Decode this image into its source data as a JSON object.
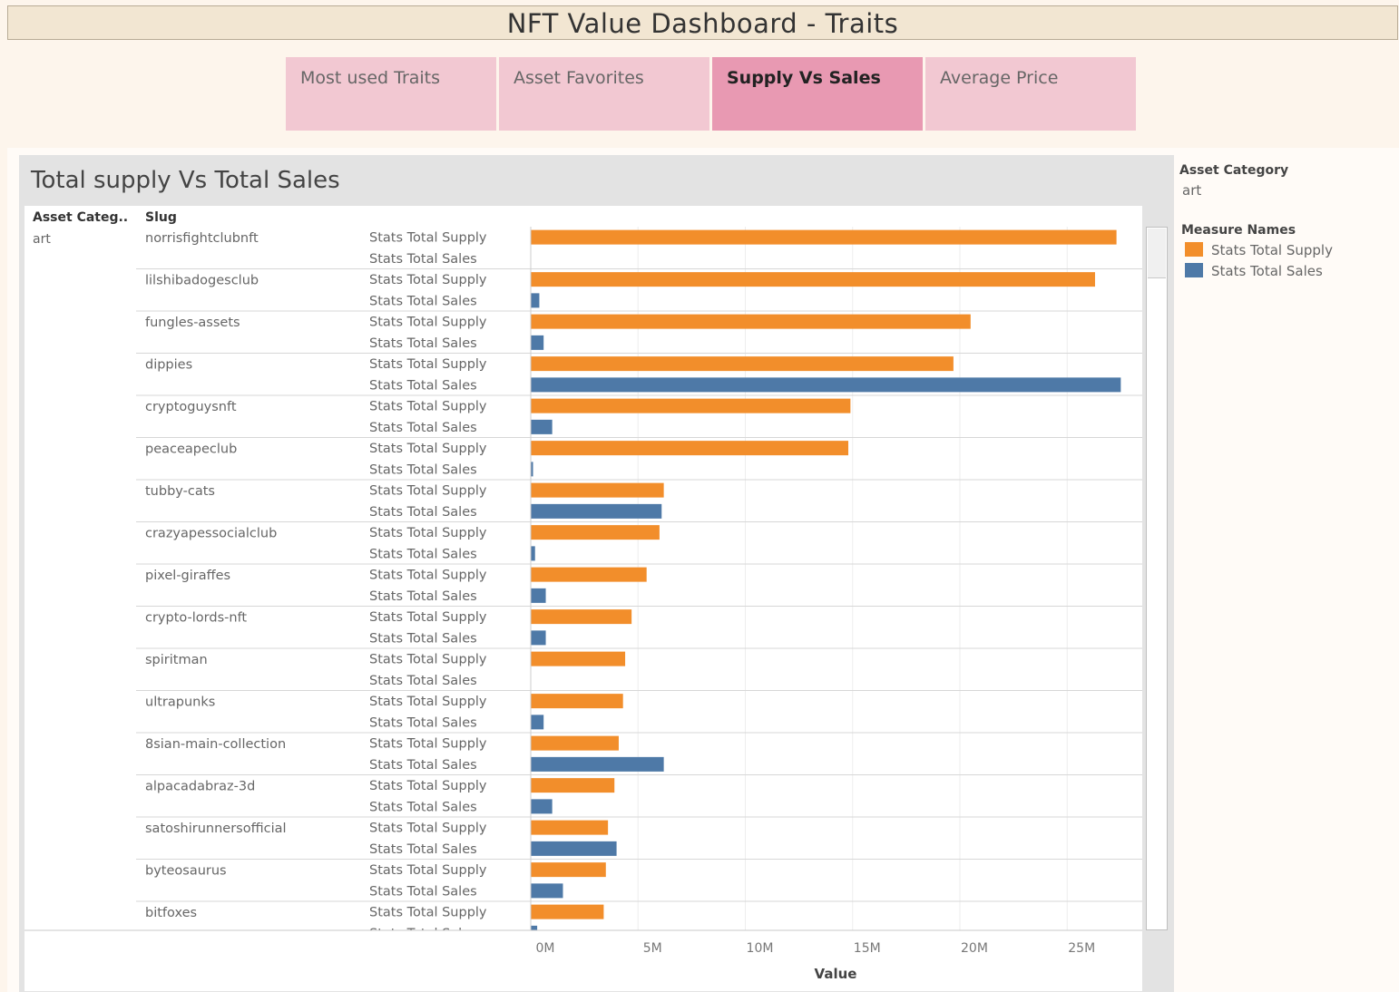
{
  "dashboard": {
    "title": "NFT Value Dashboard - Traits"
  },
  "tabs": [
    {
      "label": "Most used Traits",
      "active": false
    },
    {
      "label": "Asset Favorites",
      "active": false
    },
    {
      "label": "Supply Vs Sales",
      "active": true
    },
    {
      "label": "Average  Price",
      "active": false
    }
  ],
  "sheet": {
    "title": "Total supply Vs Total Sales",
    "col_headers": {
      "category": "Asset Categ..",
      "slug": "Slug"
    }
  },
  "legend": {
    "filter_title": "Asset Category",
    "filter_value": "art",
    "measure_title": "Measure Names",
    "items": [
      {
        "label": "Stats Total Supply",
        "color": "#f28e2b"
      },
      {
        "label": "Stats Total Sales",
        "color": "#4e79a7"
      }
    ]
  },
  "chart_data": {
    "type": "bar",
    "orientation": "horizontal",
    "category": "art",
    "categories": [
      "norrisfightclubnft",
      "lilshibadogesclub",
      "fungles-assets",
      "dippies",
      "cryptoguysnft",
      "peaceapeclub",
      "tubby-cats",
      "crazyapessocialclub",
      "pixel-giraffes",
      "crypto-lords-nft",
      "spiritman",
      "ultrapunks",
      "8sian-main-collection",
      "alpacadabraz-3d",
      "satoshirunnersofficial",
      "byteosaurus",
      "bitfoxes"
    ],
    "series": [
      {
        "name": "Stats Total Supply",
        "color": "#f28e2b",
        "values": [
          27.3,
          26.3,
          20.5,
          19.7,
          14.9,
          14.8,
          6.2,
          6.0,
          5.4,
          4.7,
          4.4,
          4.3,
          4.1,
          3.9,
          3.6,
          3.5,
          3.4
        ]
      },
      {
        "name": "Stats Total Sales",
        "color": "#4e79a7",
        "values": [
          0,
          0.4,
          0.6,
          27.5,
          1.0,
          0.1,
          6.1,
          0.2,
          0.7,
          0.7,
          0,
          0.6,
          6.2,
          1.0,
          4.0,
          1.5,
          0.3
        ]
      }
    ],
    "xlabel": "Value",
    "xticks": [
      "0M",
      "5M",
      "10M",
      "15M",
      "20M",
      "25M"
    ],
    "xlim": [
      0,
      28.5
    ],
    "unit": "M",
    "grid": true
  }
}
